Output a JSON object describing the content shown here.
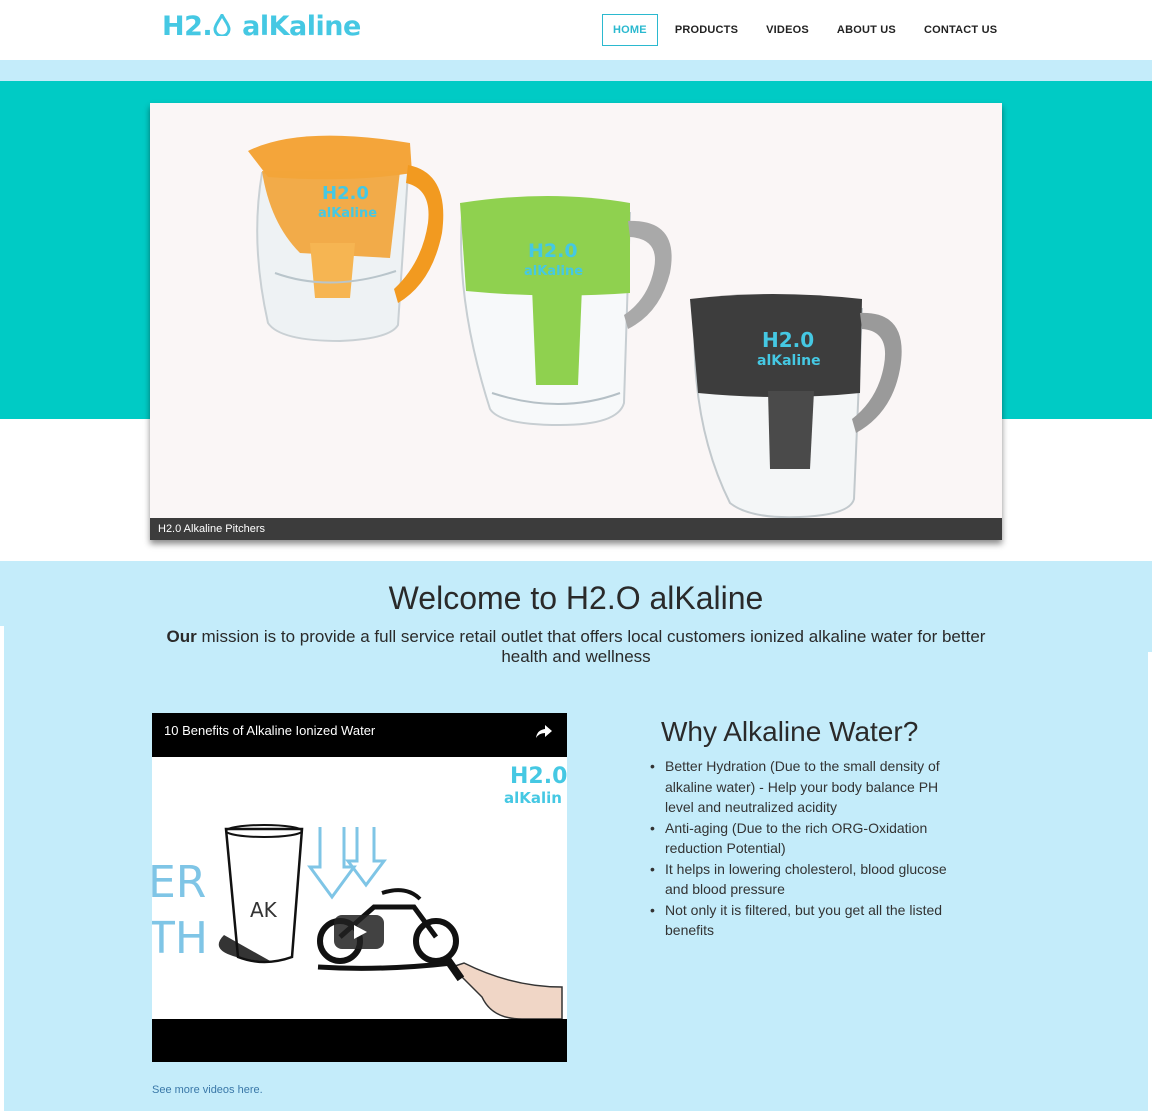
{
  "header": {
    "logo_text_left": "H2.",
    "logo_text_right": "alKaline",
    "nav": [
      {
        "label": "HOME",
        "active": true
      },
      {
        "label": "PRODUCTS",
        "active": false
      },
      {
        "label": "VIDEOS",
        "active": false
      },
      {
        "label": "ABOUT US",
        "active": false
      },
      {
        "label": "CONTACT US",
        "active": false
      }
    ]
  },
  "slider": {
    "caption": "H2.0 Alkaline Pitchers",
    "pitcher_logo_top": "H2.0",
    "pitcher_logo_bottom": "alKaline",
    "pitchers": [
      {
        "color": "orange",
        "hex": "#f2a53a"
      },
      {
        "color": "green",
        "hex": "#8fd14f"
      },
      {
        "color": "black",
        "hex": "#3a3a3a"
      }
    ]
  },
  "welcome": {
    "title": "Welcome to H2.O alKaline",
    "mission_bold": "Our",
    "mission_text": " mission is to provide a full service retail outlet that offers local customers ionized alkaline water for better health and wellness"
  },
  "video": {
    "title": "10 Benefits of Alkaline Ionized Water",
    "frame_logo_top": "H2.0",
    "frame_logo_bottom": "alKalin",
    "glass_text": "AK",
    "left_text_top": "ER",
    "left_text_bottom": "TH",
    "see_more": "See more videos here."
  },
  "why": {
    "title": "Why Alkaline Water?",
    "items": [
      "Better Hydration (Due to the small density of alkaline water) - Help your body balance PH level and neutralized acidity",
      "Anti-aging (Due to the rich ORG-Oxidation reduction Potential)",
      "It helps in lowering cholesterol, blood glucose and blood pressure",
      "Not only it is filtered, but you get all the listed benefits"
    ]
  },
  "colors": {
    "teal": "#00cbc5",
    "light_blue": "#c4ecfa",
    "logo_blue": "#45c8e3",
    "nav_active": "#2bb9cf"
  }
}
